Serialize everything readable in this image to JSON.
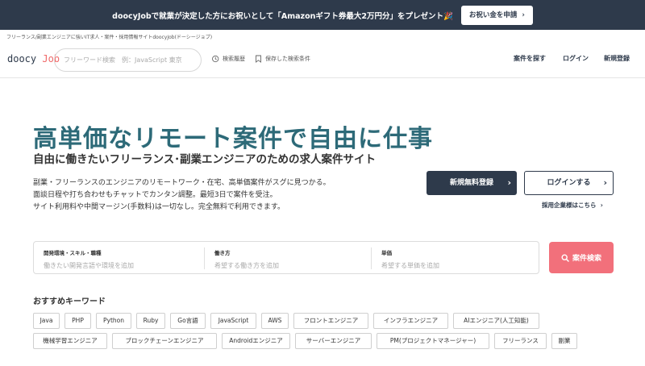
{
  "promo": {
    "text": "doocyJobで就業が決定した方にお祝いとして「Amazonギフト券最大2万円分」をプレゼント🎉",
    "button_label": "お祝い金を申請"
  },
  "breadcrumb": "フリーランス/副業エンジニアに強いIT求人・案件・採用情報サイトdoocyJob(ドーシージョブ)",
  "header": {
    "logo_main": "doocy",
    "logo_accent": "Job",
    "search_placeholder": "フリーワード検索　例：JavaScript 東京",
    "history_label": "検索履歴",
    "saved_label": "保存した検索条件",
    "nav": [
      "案件を探す",
      "ログイン",
      "新規登録"
    ]
  },
  "hero": {
    "title": "高単価なリモート案件で自由に仕事",
    "subtitle": "自由に働きたいフリーランス･副業エンジニアのための求人案件サイト",
    "description": [
      "副業・フリーランスのエンジニアのリモートワーク・在宅、高単価案件がスグに見つかる。",
      "面談日程や打ち合わせもチャットでカンタン調整。最短3日で案件を受注。",
      "サイト利用料や中間マージン(手数料)は一切なし。完全無料で利用できます。"
    ],
    "register_label": "新規無料登録",
    "login_label": "ログインする",
    "corporate_link": "採用企業様はこちら"
  },
  "search_panel": {
    "fields": [
      {
        "label": "開発環境・スキル・職種",
        "placeholder": "働きたい開発言語や環境を追加"
      },
      {
        "label": "働き方",
        "placeholder": "希望する働き方を追加"
      },
      {
        "label": "単価",
        "placeholder": "希望する単価を追加"
      }
    ],
    "button_label": "案件検索"
  },
  "keywords": {
    "title": "おすすめキーワード",
    "items": [
      "Java",
      "PHP",
      "Python",
      "Ruby",
      "Go言語",
      "JavaScript",
      "AWS",
      "フロントエンジニア",
      "インフラエンジニア",
      "AIエンジニア(人工知能)",
      "機械学習エンジニア",
      "ブロックチェーンエンジニア",
      "Androidエンジニア",
      "サーバーエンジニア",
      "PM(プロジェクトマネージャー)",
      "フリーランス",
      "副業"
    ]
  },
  "colors": {
    "navy": "#2e3a4b",
    "teal": "#2d6a78",
    "pink": "#f2707b",
    "logo_accent": "#f06a6a"
  }
}
